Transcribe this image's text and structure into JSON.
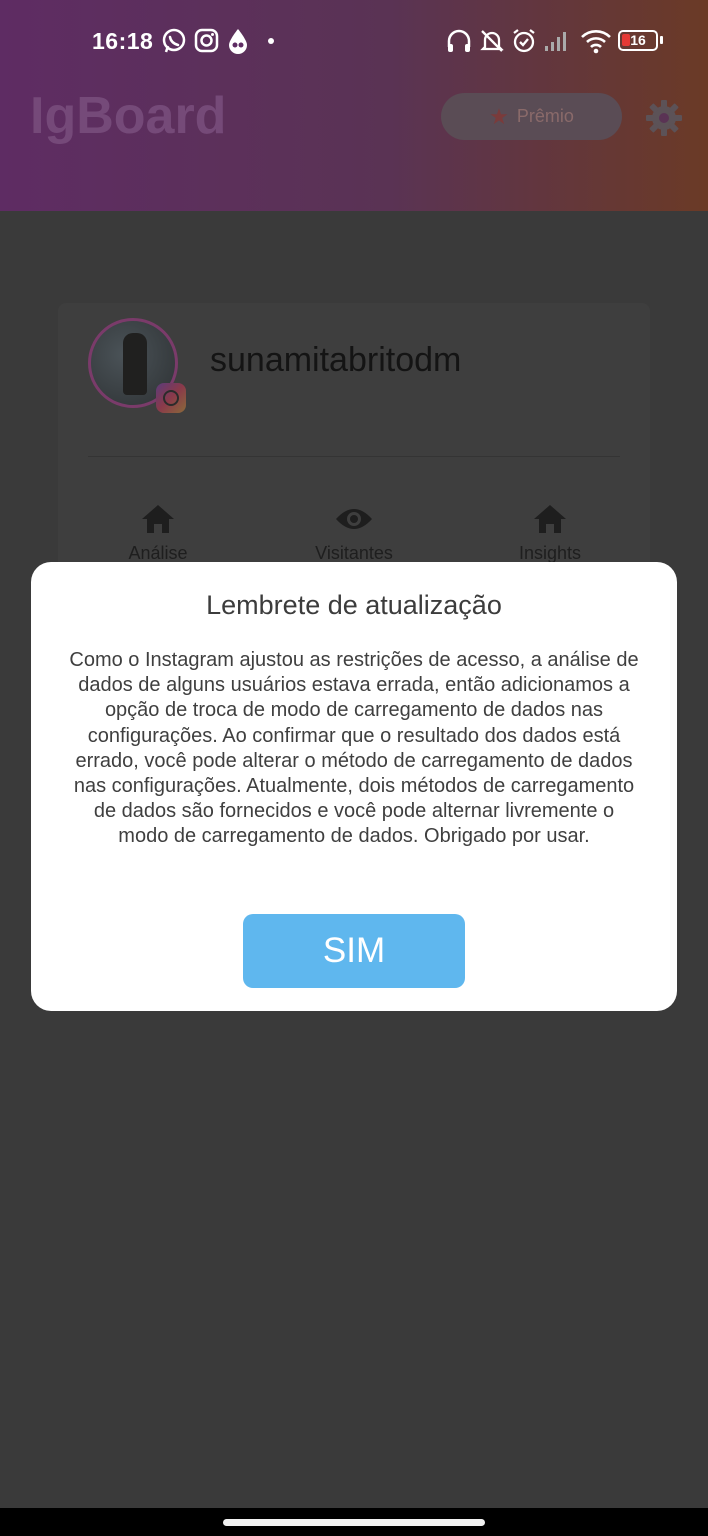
{
  "status_bar": {
    "time": "16:18",
    "notification_icons": [
      "whatsapp-icon",
      "instagram-icon",
      "drop-icon",
      "dot-icon"
    ],
    "system_icons": [
      "headphones-icon",
      "bell-muted-icon",
      "alarm-icon",
      "signal-icon",
      "wifi-icon"
    ],
    "battery": "16"
  },
  "header": {
    "title": "IgBoard",
    "premium_label": "Prêmio",
    "colors": {
      "gradient_left": "#5e2c63",
      "gradient_right": "#6b3a26"
    }
  },
  "profile": {
    "username": "sunamitabritodm"
  },
  "nav": {
    "items": [
      {
        "label": "Análise",
        "icon": "home-icon"
      },
      {
        "label": "Visitantes",
        "icon": "eye-icon"
      },
      {
        "label": "Insights",
        "icon": "home-icon"
      }
    ]
  },
  "dialog": {
    "title": "Lembrete de atualização",
    "body": "Como o Instagram ajustou as restrições de acesso, a análise de dados de alguns usuários estava errada, então adicionamos a opção de troca de modo de carregamento de dados nas configurações. Ao confirmar que o resultado dos dados está errado, você pode alterar o método de carregamento de dados nas configurações. Atualmente, dois métodos de carregamento de dados são fornecidos e você pode alternar livremente o modo de carregamento de dados. Obrigado por usar.",
    "confirm_label": "SIM",
    "colors": {
      "button": "#5fb7ee"
    }
  }
}
